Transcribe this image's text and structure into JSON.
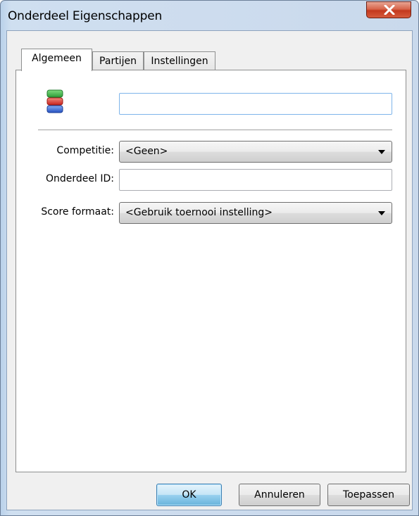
{
  "window": {
    "title": "Onderdeel Eigenschappen",
    "close_symbol": "close-icon"
  },
  "tabs": [
    {
      "label": "Algemeen",
      "active": true
    },
    {
      "label": "Partijen",
      "active": false
    },
    {
      "label": "Instellingen",
      "active": false
    }
  ],
  "general": {
    "icon": "stacked-blocks-icon",
    "name_value": "",
    "competition": {
      "label": "Competitie:",
      "value": "<Geen>"
    },
    "event_id": {
      "label": "Onderdeel ID:",
      "value": ""
    },
    "score_format": {
      "label": "Score formaat:",
      "value": "<Gebruik toernooi instelling>"
    }
  },
  "buttons": {
    "ok": "OK",
    "cancel": "Annuleren",
    "apply": "Toepassen"
  },
  "colors": {
    "accent_focus": "#7eb4ea",
    "close_button": "#c3391e",
    "icon_green": "#3aa845",
    "icon_red": "#d6342e",
    "icon_blue": "#2f66d0"
  }
}
